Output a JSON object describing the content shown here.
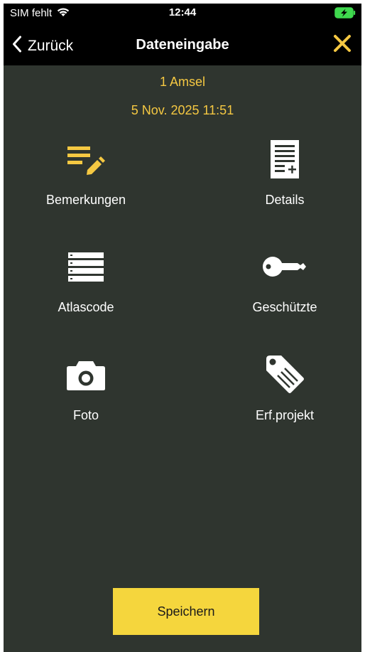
{
  "status_bar": {
    "carrier": "SIM fehlt",
    "time": "12:44",
    "icons": [
      "wifi-icon",
      "battery-charging-icon"
    ]
  },
  "nav": {
    "back_label": "Zurück",
    "title": "Dateneingabe",
    "close_icon": "close-icon"
  },
  "record": {
    "species": "1 Amsel",
    "datetime": "5 Nov. 2025 11:51"
  },
  "menu": {
    "items": [
      {
        "label": "Bemerkungen",
        "icon": "notes-edit-icon"
      },
      {
        "label": "Details",
        "icon": "document-add-icon"
      },
      {
        "label": "Atlascode",
        "icon": "list-icon"
      },
      {
        "label": "Geschützte",
        "icon": "key-icon"
      },
      {
        "label": "Foto",
        "icon": "camera-icon"
      },
      {
        "label": "Erf.projekt",
        "icon": "tags-icon"
      }
    ]
  },
  "actions": {
    "save_label": "Speichern"
  },
  "colors": {
    "background": "#2f352f",
    "bar": "#000000",
    "accent": "#f5c842",
    "save_button": "#f5d63d"
  }
}
